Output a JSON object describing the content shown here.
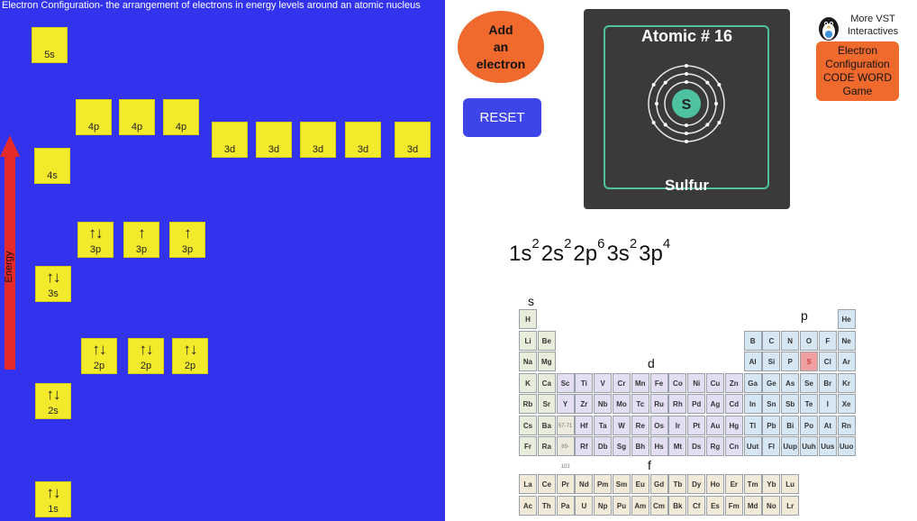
{
  "title": "Electron Configuration- the arrangement of electrons in energy levels around an atomic nucleus",
  "energy_label": "Energy",
  "orbitals": [
    {
      "id": "5s",
      "label": "5s",
      "electrons": ""
    },
    {
      "id": "4p-1",
      "label": "4p",
      "electrons": ""
    },
    {
      "id": "4p-2",
      "label": "4p",
      "electrons": ""
    },
    {
      "id": "4p-3",
      "label": "4p",
      "electrons": ""
    },
    {
      "id": "3d-1",
      "label": "3d",
      "electrons": ""
    },
    {
      "id": "3d-2",
      "label": "3d",
      "electrons": ""
    },
    {
      "id": "3d-3",
      "label": "3d",
      "electrons": ""
    },
    {
      "id": "3d-4",
      "label": "3d",
      "electrons": ""
    },
    {
      "id": "3d-5",
      "label": "3d",
      "electrons": ""
    },
    {
      "id": "4s",
      "label": "4s",
      "electrons": ""
    },
    {
      "id": "3p-1",
      "label": "3p",
      "electrons": "↑↓"
    },
    {
      "id": "3p-2",
      "label": "3p",
      "electrons": "↑"
    },
    {
      "id": "3p-3",
      "label": "3p",
      "electrons": "↑"
    },
    {
      "id": "3s",
      "label": "3s",
      "electrons": "↑↓"
    },
    {
      "id": "2p-1",
      "label": "2p",
      "electrons": "↑↓"
    },
    {
      "id": "2p-2",
      "label": "2p",
      "electrons": "↑↓"
    },
    {
      "id": "2p-3",
      "label": "2p",
      "electrons": "↑↓"
    },
    {
      "id": "2s",
      "label": "2s",
      "electrons": "↑↓"
    },
    {
      "id": "1s",
      "label": "1s",
      "electrons": "↑↓"
    }
  ],
  "buttons": {
    "add_line1": "Add",
    "add_line2": "an",
    "add_line3": "electron",
    "reset": "RESET"
  },
  "atom": {
    "atomic_number_text": "Atomic # 16",
    "symbol": "S",
    "name": "Sulfur",
    "shells": [
      2,
      8,
      6
    ]
  },
  "vst": {
    "line1": "More VST",
    "line2": "Interactives",
    "game_line1": "Electron",
    "game_line2": "Configuration",
    "game_line3": "CODE WORD",
    "game_line4": "Game"
  },
  "configuration": [
    {
      "orbital": "1s",
      "count": "2"
    },
    {
      "orbital": "2s",
      "count": "2"
    },
    {
      "orbital": "2p",
      "count": "6"
    },
    {
      "orbital": "3s",
      "count": "2"
    },
    {
      "orbital": "3p",
      "count": "4"
    }
  ],
  "block_labels": {
    "s": "s",
    "p": "p",
    "d": "d",
    "f": "f"
  },
  "periodic_table": {
    "highlight": "S",
    "rows": [
      [
        "H",
        "",
        "",
        "",
        "",
        "",
        "",
        "",
        "",
        "",
        "",
        "",
        "",
        "",
        "",
        "",
        "",
        "He"
      ],
      [
        "Li",
        "Be",
        "",
        "",
        "",
        "",
        "",
        "",
        "",
        "",
        "",
        "",
        "B",
        "C",
        "N",
        "O",
        "F",
        "Ne"
      ],
      [
        "Na",
        "Mg",
        "",
        "",
        "",
        "",
        "",
        "",
        "",
        "",
        "",
        "",
        "Al",
        "Si",
        "P",
        "S",
        "Cl",
        "Ar"
      ],
      [
        "K",
        "Ca",
        "Sc",
        "Ti",
        "V",
        "Cr",
        "Mn",
        "Fe",
        "Co",
        "Ni",
        "Cu",
        "Zn",
        "Ga",
        "Ge",
        "As",
        "Se",
        "Br",
        "Kr"
      ],
      [
        "Rb",
        "Sr",
        "Y",
        "Zr",
        "Nb",
        "Mo",
        "Tc",
        "Ru",
        "Rh",
        "Pd",
        "Ag",
        "Cd",
        "In",
        "Sn",
        "Sb",
        "Te",
        "I",
        "Xe"
      ],
      [
        "Cs",
        "Ba",
        "57-71",
        "Hf",
        "Ta",
        "W",
        "Re",
        "Os",
        "Ir",
        "Pt",
        "Au",
        "Hg",
        "Tl",
        "Pb",
        "Bi",
        "Po",
        "At",
        "Rn"
      ],
      [
        "Fr",
        "Ra",
        "89-103",
        "Rf",
        "Db",
        "Sg",
        "Bh",
        "Hs",
        "Mt",
        "Ds",
        "Rg",
        "Cn",
        "Uut",
        "Fl",
        "Uup",
        "Uuh",
        "Uus",
        "Uuo"
      ]
    ],
    "f_rows": [
      [
        "La",
        "Ce",
        "Pr",
        "Nd",
        "Pm",
        "Sm",
        "Eu",
        "Gd",
        "Tb",
        "Dy",
        "Ho",
        "Er",
        "Tm",
        "Yb",
        "Lu"
      ],
      [
        "Ac",
        "Th",
        "Pa",
        "U",
        "Np",
        "Pu",
        "Am",
        "Cm",
        "Bk",
        "Cf",
        "Es",
        "Fm",
        "Md",
        "No",
        "Lr"
      ]
    ]
  },
  "colors": {
    "panel_blue": "#3333ee",
    "orbital_yellow": "#f2ea2a",
    "energy_arrow": "#e62a2a",
    "add_button": "#ef6a2c",
    "reset_button": "#3d44e8",
    "atom_panel": "#3a3a3a",
    "atom_accent": "#4ec2a0",
    "highlight_element": "#f0a0a0"
  }
}
